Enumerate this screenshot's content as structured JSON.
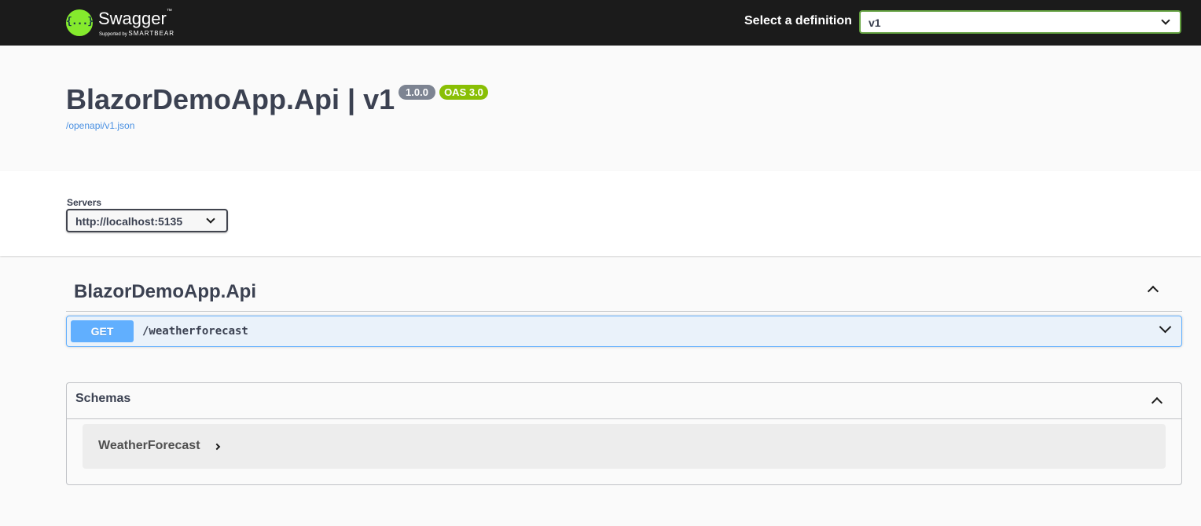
{
  "topbar": {
    "logo": {
      "glyph": "{...}",
      "name": "Swagger",
      "tagline": "Supported by",
      "brand": "SMARTBEAR"
    },
    "definition_label": "Select a definition",
    "definition_value": "v1"
  },
  "info": {
    "title": "BlazorDemoApp.Api | v1",
    "version_badge": "1.0.0",
    "oas_badge": "OAS 3.0",
    "spec_link": "/openapi/v1.json"
  },
  "servers": {
    "label": "Servers",
    "selected": "http://localhost:5135"
  },
  "tag": {
    "name": "BlazorDemoApp.Api",
    "operations": [
      {
        "method": "GET",
        "path": "/weatherforecast"
      }
    ]
  },
  "schemas": {
    "title": "Schemas",
    "models": [
      {
        "name": "WeatherForecast"
      }
    ]
  },
  "colors": {
    "topbar_bg": "#1b1b1b",
    "logo_green": "#85ea2d",
    "get_blue": "#61affe",
    "oas_green": "#89bf04",
    "version_gray": "#7d8492",
    "link_blue": "#4990e2"
  }
}
